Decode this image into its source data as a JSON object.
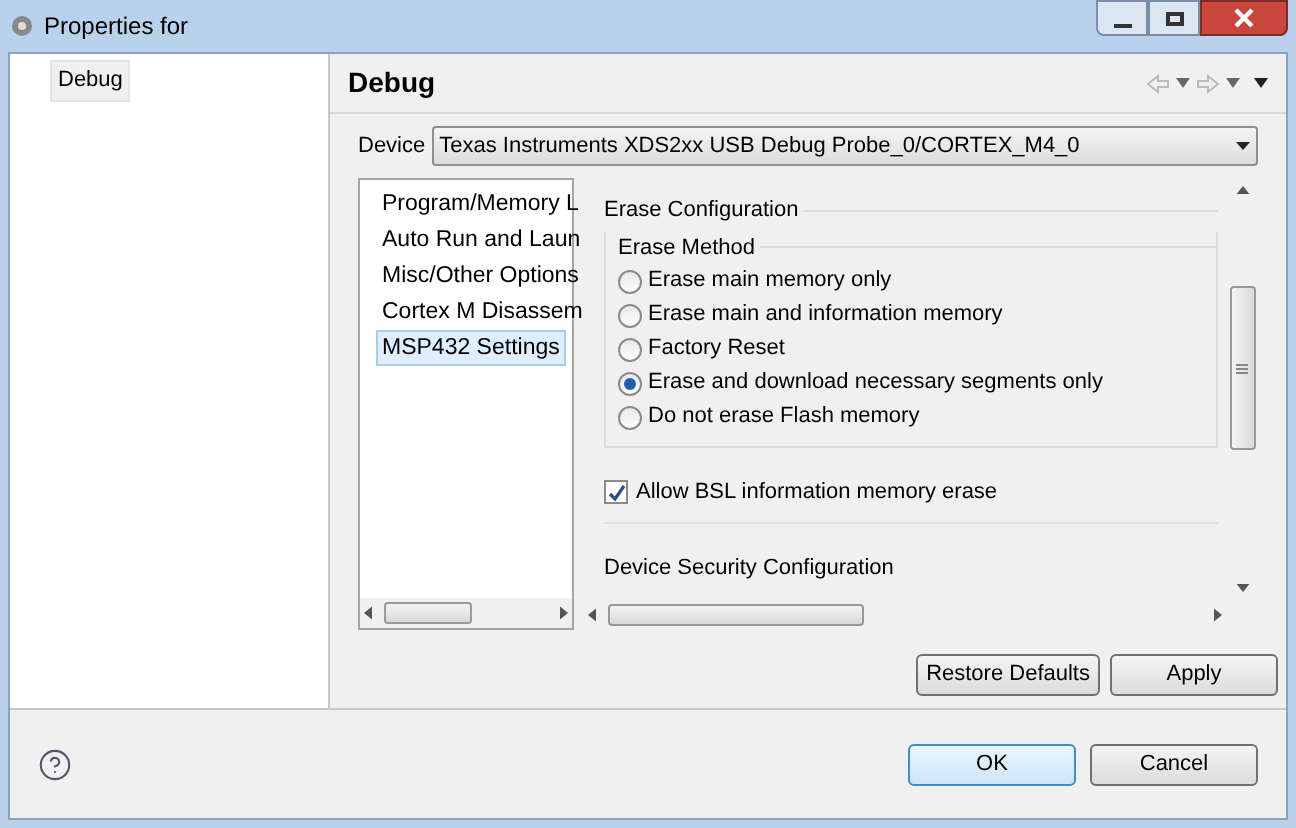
{
  "window": {
    "title": "Properties for"
  },
  "tree": [
    {
      "label": "Debug",
      "selected": true
    }
  ],
  "page": {
    "title": "Debug"
  },
  "device": {
    "label": "Device",
    "value": "Texas Instruments XDS2xx USB Debug Probe_0/CORTEX_M4_0"
  },
  "categories": [
    {
      "label": "Program/Memory L",
      "selected": false
    },
    {
      "label": "Auto Run and Laun",
      "selected": false
    },
    {
      "label": "Misc/Other Options",
      "selected": false
    },
    {
      "label": "Cortex M Disassem",
      "selected": false
    },
    {
      "label": "MSP432 Settings",
      "selected": true
    }
  ],
  "erase_configuration": {
    "title": "Erase Configuration",
    "method_title": "Erase Method",
    "options": [
      {
        "label": "Erase main memory only",
        "selected": false
      },
      {
        "label": "Erase main and information memory",
        "selected": false
      },
      {
        "label": "Factory Reset",
        "selected": false
      },
      {
        "label": "Erase and download necessary segments only",
        "selected": true
      },
      {
        "label": "Do not erase Flash memory",
        "selected": false
      }
    ],
    "allow_bsl": {
      "label": "Allow BSL information memory erase",
      "checked": true
    }
  },
  "next_section": {
    "title": "Device Security Configuration"
  },
  "page_buttons": [
    "Restore Defaults",
    "Apply"
  ],
  "dialog_buttons": [
    {
      "label": "OK",
      "default": true
    },
    {
      "label": "Cancel",
      "default": false
    }
  ]
}
